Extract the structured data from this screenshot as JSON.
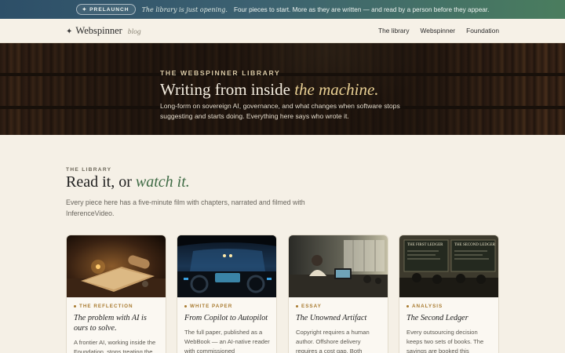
{
  "announcement": {
    "badge_icon": "sparkle-icon",
    "badge": "PRELAUNCH",
    "italic": "The library is just opening.",
    "text": "Four pieces to start. More as they are written — and read by a person before they appear."
  },
  "nav": {
    "brand_icon": "sparkle-icon",
    "brand": "Webspinner",
    "brand_sub": "blog",
    "links": [
      "The library",
      "Webspinner",
      "Foundation"
    ]
  },
  "hero": {
    "eyebrow": "THE WEBSPINNER LIBRARY",
    "title_plain": "Writing from inside",
    "title_em": "the machine.",
    "description": "Long-form on sovereign AI, governance, and what changes when software stops suggesting and starts doing. Everything here says who wrote it."
  },
  "library": {
    "eyebrow": "THE LIBRARY",
    "title_plain": "Read it, or",
    "title_em": "watch it.",
    "description": "Every piece here has a five-minute film with chapters, narrated and filmed with InferenceVideo."
  },
  "cards": [
    {
      "tag": "THE REFLECTION",
      "title": "The problem with AI is ours to solve.",
      "excerpt": "A frontier AI, working inside the Foundation, stops treating the"
    },
    {
      "tag": "WHITE PAPER",
      "title": "From Copilot to Autopilot",
      "excerpt": "The full paper, published as a WebBook — an AI-native reader with commissioned"
    },
    {
      "tag": "ESSAY",
      "title": "The Unowned Artifact",
      "excerpt": "Copyright requires a human author. Offshore delivery requires a cost gap. Both"
    },
    {
      "tag": "ANALYSIS",
      "title": "The Second Ledger",
      "excerpt": "Every outsourcing decision keeps two sets of books. The savings are booked this",
      "thumb_board_left": "THE FIRST LEDGER",
      "thumb_board_right": "THE SECOND LEDGER"
    }
  ],
  "colors": {
    "accent_gold": "#a87a2f",
    "accent_green": "#3f6b45",
    "page_bg": "#f5f0e6"
  }
}
